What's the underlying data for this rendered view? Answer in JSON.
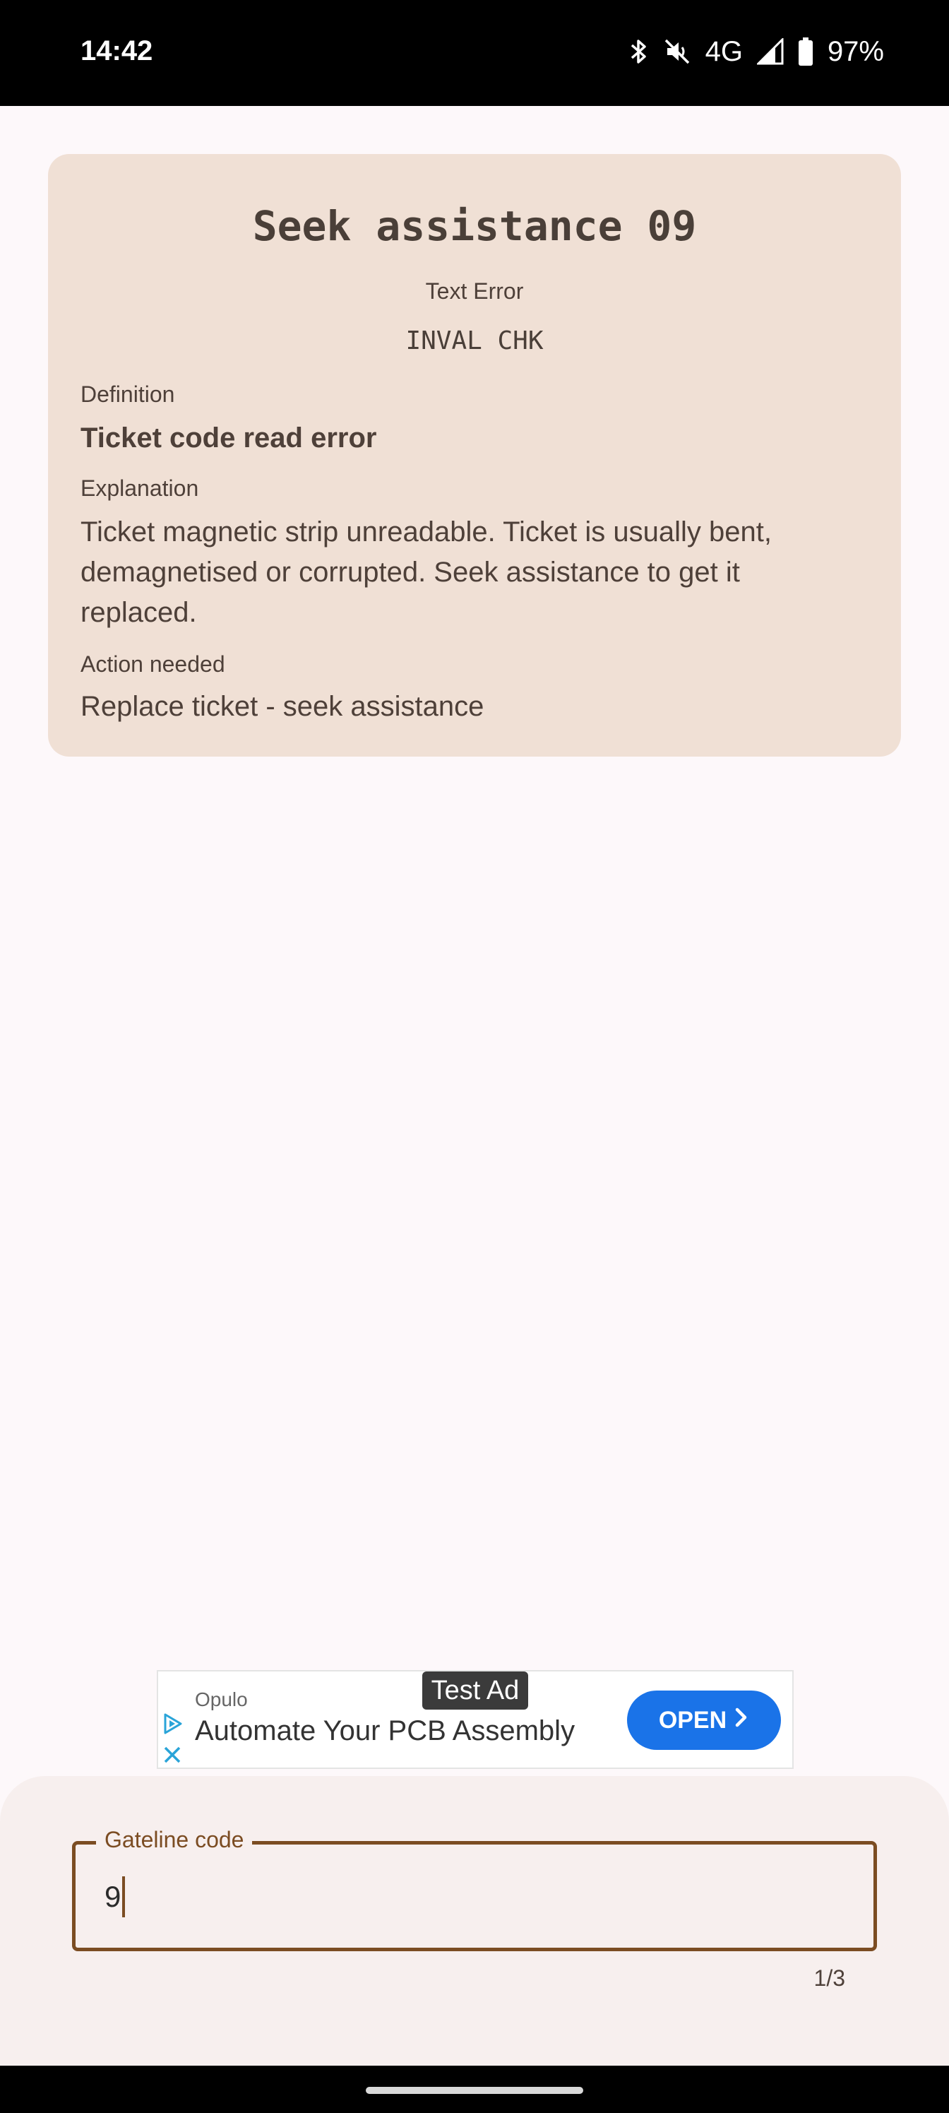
{
  "status_bar": {
    "time": "14:42",
    "network": "4G",
    "battery": "97%",
    "icons": [
      "bluetooth-icon",
      "mute-icon",
      "signal-icon",
      "battery-icon"
    ]
  },
  "error_card": {
    "title": "Seek assistance 09",
    "text_error_label": "Text Error",
    "text_error_code": "INVAL CHK",
    "definition_label": "Definition",
    "definition_value": "Ticket code read error",
    "explanation_label": "Explanation",
    "explanation_value": "Ticket magnetic strip unreadable. Ticket is usually bent, demagnetised or corrupted. Seek assistance to get it replaced.",
    "action_label": "Action needed",
    "action_value": "Replace ticket - seek assistance"
  },
  "ad": {
    "badge": "Test Ad",
    "advertiser": "Opulo",
    "headline": "Automate Your PCB Assembly",
    "cta": "OPEN"
  },
  "input": {
    "label": "Gateline code",
    "value": "9",
    "counter": "1/3"
  },
  "colors": {
    "card_bg": "#f0e0d5",
    "accent": "#7b4c22",
    "ad_button": "#1a73e8"
  }
}
